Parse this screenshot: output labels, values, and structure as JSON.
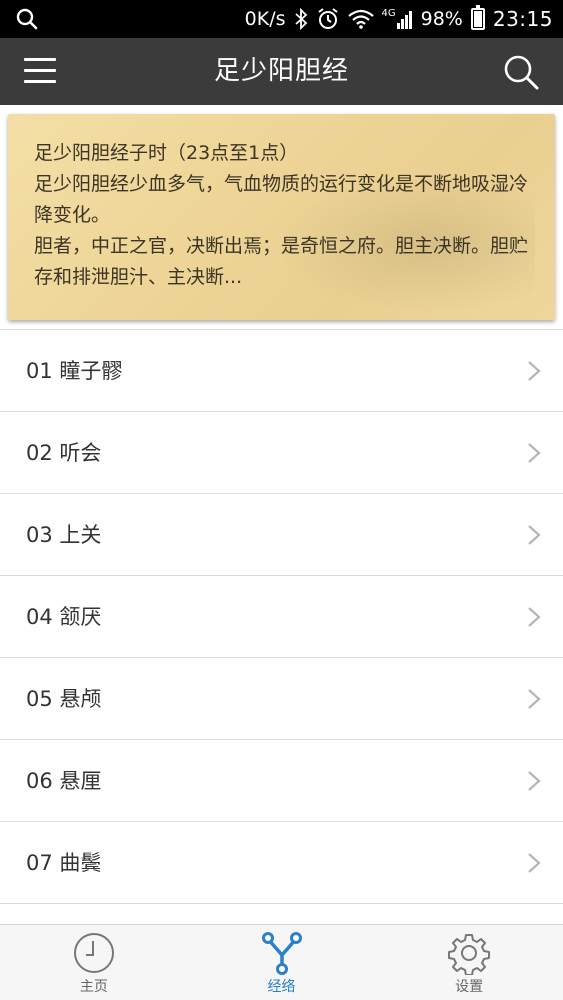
{
  "status_bar": {
    "speed": "0K/s",
    "network": "4G",
    "battery": "98%",
    "battery_level": 0.98,
    "time": "23:15",
    "icons": [
      "search-icon",
      "bluetooth-icon",
      "alarm-icon",
      "wifi-icon",
      "signal-icon",
      "battery-icon"
    ]
  },
  "app_bar": {
    "title": "足少阳胆经",
    "menu_icon": "hamburger-menu-icon",
    "search_icon": "search-icon"
  },
  "intro": {
    "lines": [
      "足少阳胆经子时（23点至1点）",
      "足少阳胆经少血多气，气血物质的运行变化是不断地吸湿冷降变化。",
      "胆者，中正之官，决断出焉；是奇恒之府。胆主决断。胆贮存和排泄胆汁、主决断..."
    ]
  },
  "acupoints": [
    {
      "label": "01 瞳子髎"
    },
    {
      "label": "02 听会"
    },
    {
      "label": "03 上关"
    },
    {
      "label": "04 颔厌"
    },
    {
      "label": "05 悬颅"
    },
    {
      "label": "06 悬厘"
    },
    {
      "label": "07 曲鬓"
    }
  ],
  "bottom_nav": {
    "tabs": [
      {
        "label": "主页",
        "icon": "clock-icon",
        "active": false
      },
      {
        "label": "经络",
        "icon": "meridian-branch-icon",
        "active": true
      },
      {
        "label": "设置",
        "icon": "gear-icon",
        "active": false
      }
    ]
  },
  "colors": {
    "app_bar": "#3b3b3b",
    "accent": "#2c7fc9",
    "card": "#eed597"
  }
}
